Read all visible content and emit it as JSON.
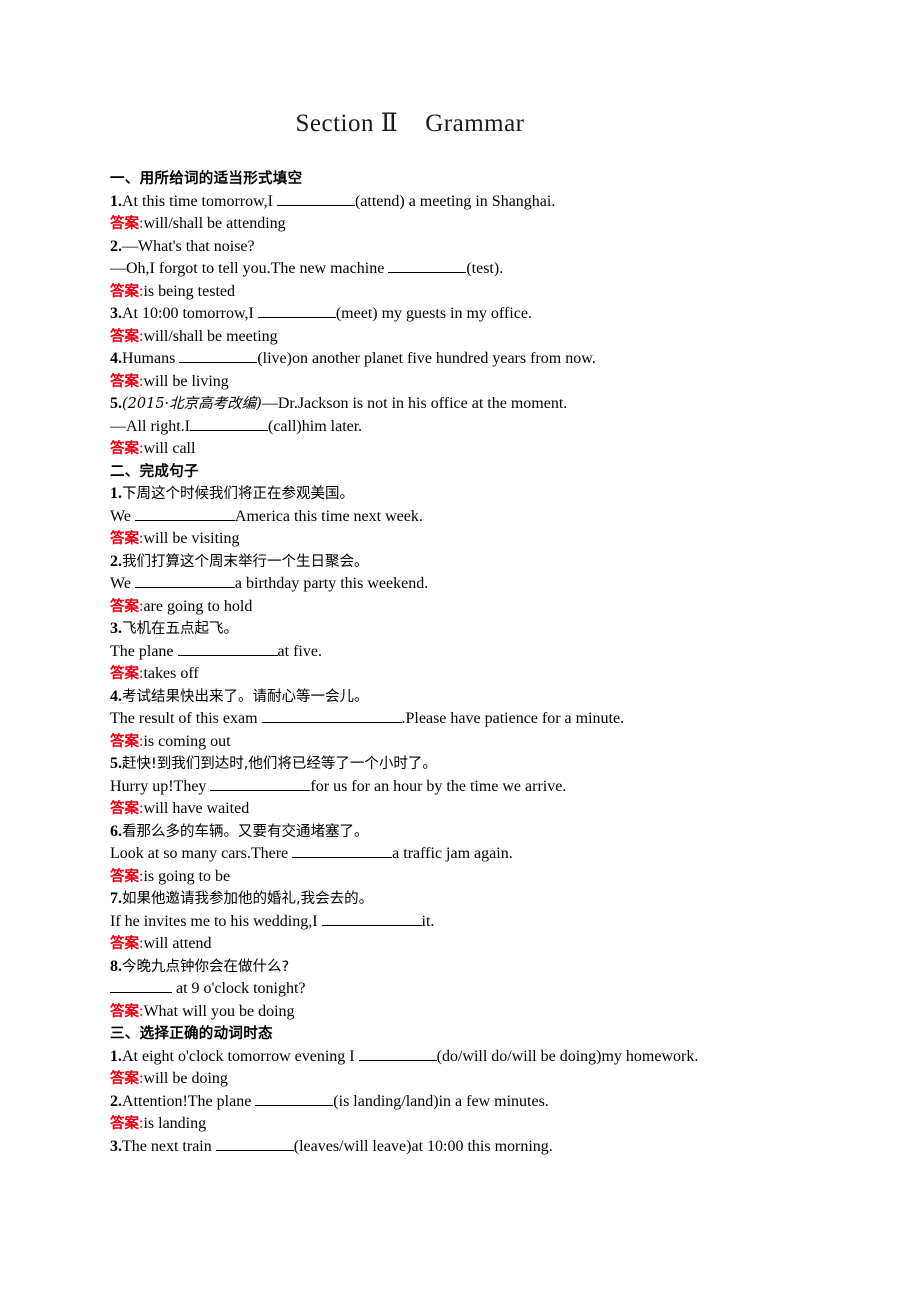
{
  "document": {
    "title": "Section Ⅱ    Grammar",
    "answer_label": "答案",
    "answer_colon": ":",
    "accent_color": "#e60012",
    "text_color": "#000000",
    "background_color": "#ffffff"
  },
  "sections": [
    {
      "heading": "一、用所给词的适当形式填空",
      "items": [
        {
          "number": "1.",
          "lines": [
            {
              "pre": "At this time tomorrow,I ",
              "blank": 78,
              "post": "(attend) a meeting in Shanghai."
            }
          ],
          "answer": "will/shall be attending"
        },
        {
          "number": "2.",
          "lines": [
            {
              "pre": "—What's that noise?",
              "blank": 0,
              "post": ""
            },
            {
              "pre": "—Oh,I forgot to tell you.The new machine ",
              "blank": 78,
              "post": "(test)."
            }
          ],
          "answer": "is being tested"
        },
        {
          "number": "3.",
          "lines": [
            {
              "pre": "At 10:00 tomorrow,I ",
              "blank": 78,
              "post": "(meet) my guests in my office."
            }
          ],
          "answer": "will/shall be meeting"
        },
        {
          "number": "4.",
          "lines": [
            {
              "pre": "Humans ",
              "blank": 78,
              "post": "(live)on another planet five hundred years from now."
            }
          ],
          "answer": "will be living"
        },
        {
          "number": "5.",
          "source": "(2015·北京高考改编)",
          "lines": [
            {
              "pre": "—Dr.Jackson is not in his office at the moment.",
              "blank": 0,
              "post": ""
            },
            {
              "pre": "—All right.I",
              "blank": 78,
              "post": "(call)him later."
            }
          ],
          "answer": "will call"
        }
      ]
    },
    {
      "heading": "二、完成句子",
      "items": [
        {
          "number": "1.",
          "cn": "下周这个时候我们将正在参观美国。",
          "lines": [
            {
              "pre": "We ",
              "blank": 100,
              "post": "America this time next week."
            }
          ],
          "answer": "will be visiting"
        },
        {
          "number": "2.",
          "cn": "我们打算这个周末举行一个生日聚会。",
          "lines": [
            {
              "pre": "We ",
              "blank": 100,
              "post": "a birthday party this weekend."
            }
          ],
          "answer": "are going to hold"
        },
        {
          "number": "3.",
          "cn": "飞机在五点起飞。",
          "lines": [
            {
              "pre": "The plane ",
              "blank": 100,
              "post": "at five."
            }
          ],
          "answer": "takes off"
        },
        {
          "number": "4.",
          "cn": "考试结果快出来了。请耐心等一会儿。",
          "lines": [
            {
              "pre": "The result of this exam ",
              "blank": 140,
              "post": ".Please have patience for a minute."
            }
          ],
          "answer": "is coming out"
        },
        {
          "number": "5.",
          "cn": "赶快!到我们到达时,他们将已经等了一个小时了。",
          "lines": [
            {
              "pre": "Hurry up!They ",
              "blank": 100,
              "post": "for us for an hour by the time we arrive."
            }
          ],
          "answer": "will have waited"
        },
        {
          "number": "6.",
          "cn": "看那么多的车辆。又要有交通堵塞了。",
          "lines": [
            {
              "pre": "Look at so many cars.There ",
              "blank": 100,
              "post": "a traffic jam again."
            }
          ],
          "answer": "is going to be"
        },
        {
          "number": "7.",
          "cn": "如果他邀请我参加他的婚礼,我会去的。",
          "lines": [
            {
              "pre": "If he invites me to his wedding,I ",
              "blank": 100,
              "post": "it."
            }
          ],
          "answer": "will attend"
        },
        {
          "number": "8.",
          "cn": "今晚九点钟你会在做什么?",
          "lines": [
            {
              "pre": "",
              "blank": 62,
              "post": " at 9 o'clock tonight?"
            }
          ],
          "answer": "What will you be doing"
        }
      ]
    },
    {
      "heading": "三、选择正确的动词时态",
      "items": [
        {
          "number": "1.",
          "lines": [
            {
              "pre": "At eight o'clock tomorrow evening I ",
              "blank": 78,
              "post": "(do/will do/will be doing)my homework."
            }
          ],
          "answer": "will be doing"
        },
        {
          "number": "2.",
          "lines": [
            {
              "pre": "Attention!The plane ",
              "blank": 78,
              "post": "(is landing/land)in a few minutes."
            }
          ],
          "answer": "is landing"
        },
        {
          "number": "3.",
          "lines": [
            {
              "pre": "The next train ",
              "blank": 78,
              "post": "(leaves/will leave)at 10:00 this morning."
            }
          ],
          "answer": ""
        }
      ]
    }
  ]
}
